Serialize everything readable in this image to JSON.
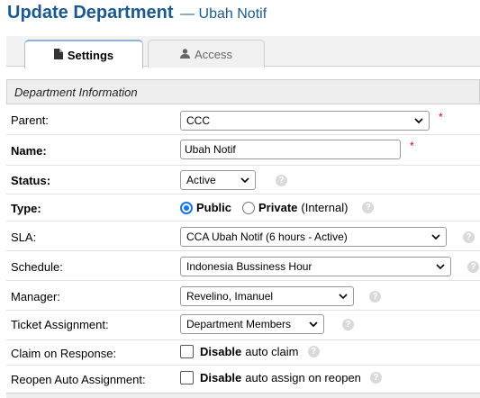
{
  "page": {
    "title": "Update Department",
    "subtitle": "— Ubah Notif"
  },
  "tabs": [
    {
      "label": "Settings",
      "icon": "file-icon",
      "active": true
    },
    {
      "label": "Access",
      "icon": "user-icon",
      "active": false
    }
  ],
  "section": {
    "title": "Department Information"
  },
  "fields": {
    "parent": {
      "label": "Parent:",
      "value": "CCC",
      "required_mark": "*"
    },
    "name": {
      "label": "Name:",
      "value": "Ubah Notif",
      "required_mark": "*"
    },
    "status": {
      "label": "Status:",
      "value": "Active"
    },
    "type": {
      "label": "Type:",
      "options": [
        {
          "label": "Public",
          "selected": true
        },
        {
          "label": "Private",
          "suffix": "(Internal)",
          "selected": false
        }
      ]
    },
    "sla": {
      "label": "SLA:",
      "value": "CCA Ubah Notif (6 hours - Active)"
    },
    "schedule": {
      "label": "Schedule:",
      "value": "Indonesia Bussiness Hour"
    },
    "manager": {
      "label": "Manager:",
      "value": "Revelino, Imanuel"
    },
    "ticket_assignment": {
      "label": "Ticket Assignment:",
      "value": "Department Members"
    },
    "claim_on_response": {
      "label": "Claim on Response:",
      "bold": "Disable",
      "text": "auto claim",
      "checked": false
    },
    "reopen_auto_assignment": {
      "label": "Reopen Auto Assignment:",
      "bold": "Disable",
      "text": "auto assign on reopen",
      "checked": false
    }
  },
  "help_glyph": "?",
  "colors": {
    "title": "#1a5a8e",
    "required": "#dd0000",
    "radio_accent": "#1a73e8"
  }
}
